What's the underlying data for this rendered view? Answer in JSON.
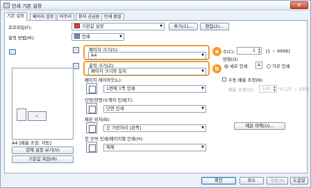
{
  "window": {
    "title": "인쇄 기본 설정",
    "close_label": "✕"
  },
  "tabs": [
    "기본 설정",
    "페이지 설정",
    "마무리",
    "용지 공급원",
    "인쇄 품질"
  ],
  "profile": {
    "label": "프로파일(F):",
    "value": "기본값 설정",
    "add_button": "추가(1)...",
    "edit_button": "편집(2)..."
  },
  "output_method": {
    "label": "출력 방법(M):",
    "value": "인쇄"
  },
  "page_size": {
    "label": "페이지 크기(S):",
    "value": "A4"
  },
  "output_size": {
    "label": "출력 크기(Z):",
    "value": "페이지 크기와 일치"
  },
  "badges": {
    "a": "a",
    "b": "b"
  },
  "copies": {
    "label": "수(C):",
    "value": "1",
    "range": "[1 ~ 9999]"
  },
  "orientation": {
    "label": "방향(O)",
    "portrait": "세로 인쇄",
    "landscape": "가로 인쇄",
    "portrait_glyph": "A",
    "landscape_glyph": "A"
  },
  "manual_scaling": {
    "label": "수동 배율 조정(N)",
    "scale_label": "배율 조정(Q):",
    "scale_value": "100",
    "scale_range": "% [25 ~ 200]"
  },
  "page_layout": {
    "label": "페이지 레이아웃(L):",
    "value": "1면에 1쪽 인쇄"
  },
  "duplex": {
    "label": "단면/양면/소책자 인쇄(T):",
    "value": "단면 인쇄"
  },
  "binding": {
    "label": "제본 위치(B):",
    "value": "긴 가장자리 [왼쪽]",
    "margin_button": "제본 여백(U)..."
  },
  "collate": {
    "label": "한 부씩 인쇄/페이지별 인쇄(H):",
    "value": "해제"
  },
  "preview": {
    "caption": "A4 [배율 조정: 자동]",
    "view_settings": "현재 설정 보기(V)",
    "restore": "기본값 복원(R)"
  },
  "footer": {
    "ok": "확인",
    "cancel": "취소",
    "apply": "적용(A)",
    "help": "도움말"
  }
}
